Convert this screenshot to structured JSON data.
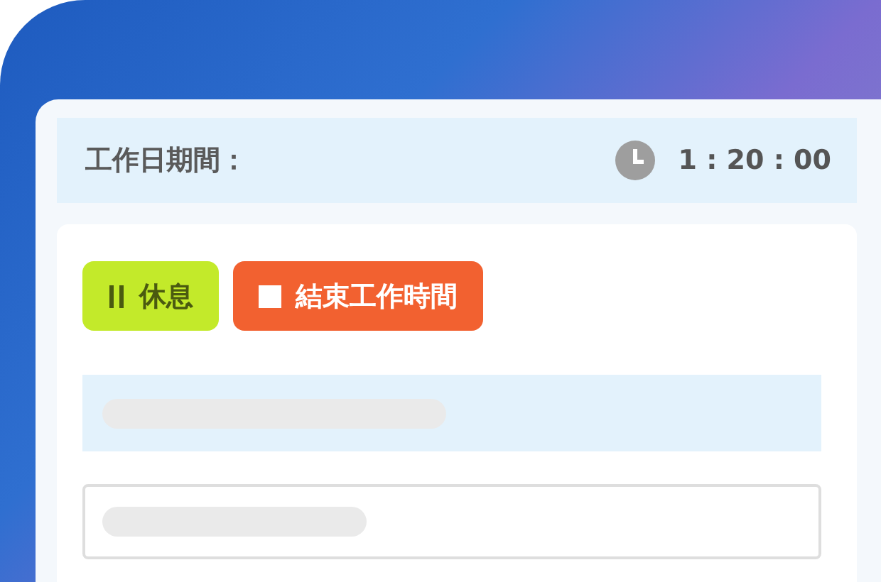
{
  "header": {
    "label": "工作日期間：",
    "elapsed": "1 : 20 : 00"
  },
  "buttons": [
    {
      "kind": "pause",
      "label": "休息"
    },
    {
      "kind": "stop",
      "label": "結束工作時間"
    }
  ]
}
